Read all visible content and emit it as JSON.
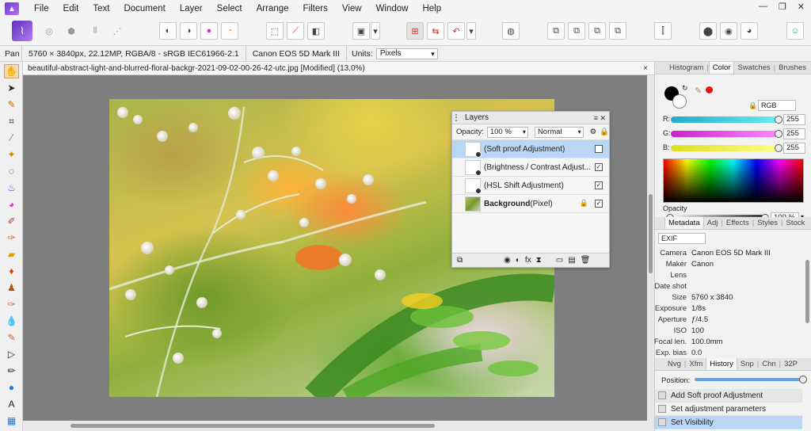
{
  "menubar": {
    "items": [
      "File",
      "Edit",
      "Text",
      "Document",
      "Layer",
      "Select",
      "Arrange",
      "Filters",
      "View",
      "Window",
      "Help"
    ]
  },
  "context": {
    "tool": "Pan",
    "doc_info": "5760 × 3840px, 22.12MP, RGBA/8 - sRGB IEC61966-2.1",
    "camera": "Canon EOS 5D Mark III",
    "units_label": "Units:",
    "units_value": "Pixels"
  },
  "document": {
    "tab_title": "beautiful-abstract-light-and-blurred-floral-backgr-2021-09-02-00-26-42-utc.jpg [Modified] (13.0%)",
    "close": "×"
  },
  "layers": {
    "title": "Layers",
    "opacity_label": "Opacity:",
    "opacity_value": "100 %",
    "blend_mode": "Normal",
    "rows": [
      {
        "name": "(Soft proof Adjustment)",
        "suffix": "",
        "checked": "",
        "selected": true
      },
      {
        "name": "(Brightness / Contrast Adjust...",
        "suffix": "",
        "checked": "✓",
        "selected": false
      },
      {
        "name": "(HSL Shift Adjustment)",
        "suffix": "",
        "checked": "✓",
        "selected": false
      },
      {
        "name": "Background",
        "suffix": " (Pixel)",
        "checked": "✓",
        "selected": false
      }
    ]
  },
  "right_panel": {
    "top_tabs": [
      "Histogram",
      "Color",
      "Swatches",
      "Brushes"
    ],
    "color": {
      "model": "RGB",
      "r_label": "R:",
      "r_value": "255",
      "g_label": "G:",
      "g_value": "255",
      "b_label": "B:",
      "b_value": "255",
      "opacity_label": "Opacity",
      "opacity_value": "100 %"
    },
    "mid_tabs": [
      "Metadata",
      "Adj",
      "Effects",
      "Styles",
      "Stock"
    ],
    "metadata": {
      "preset": "EXIF",
      "rows": [
        {
          "k": "Camera",
          "v": "Canon EOS 5D Mark III"
        },
        {
          "k": "Maker",
          "v": "Canon"
        },
        {
          "k": "Lens",
          "v": ""
        },
        {
          "k": "Date shot",
          "v": ""
        },
        {
          "k": "Size",
          "v": "5760 x 3840"
        },
        {
          "k": "Exposure",
          "v": "1/8s"
        },
        {
          "k": "Aperture",
          "v": "ƒ/4.5"
        },
        {
          "k": "ISO",
          "v": "100"
        },
        {
          "k": "Focal len.",
          "v": "100.0mm"
        },
        {
          "k": "Exp. bias",
          "v": "0.0"
        }
      ]
    },
    "bottom_tabs": [
      "Nvg",
      "Xfm",
      "History",
      "Snp",
      "Chn",
      "32P"
    ],
    "history": {
      "position_label": "Position:",
      "items": [
        "Add Soft proof Adjustment",
        "Set adjustment parameters",
        "Set Visibility"
      ]
    }
  },
  "colors": {
    "accent": "#b9d7f5",
    "brand": "#7b4fd8"
  }
}
